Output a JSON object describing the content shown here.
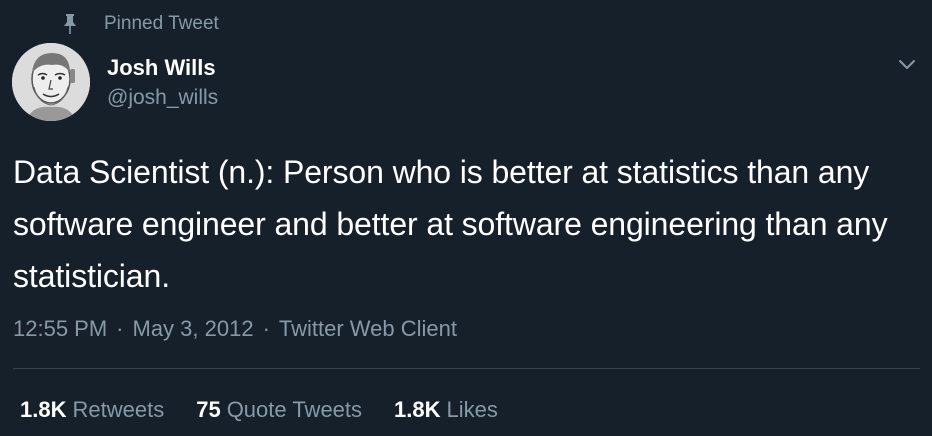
{
  "pinned": {
    "label": "Pinned Tweet",
    "icon": "pin-icon"
  },
  "author": {
    "name": "Josh Wills",
    "handle": "@josh_wills",
    "avatar_icon": "sketch-portrait"
  },
  "tweet": {
    "text": "Data Scientist (n.): Person who is better at statistics than any software engineer and better at software engineering than any statistician.",
    "time": "12:55 PM",
    "date": "May 3, 2012",
    "separator": "·",
    "source": "Twitter Web Client"
  },
  "stats": {
    "retweets_count": "1.8K",
    "retweets_label": "Retweets",
    "quotes_count": "75",
    "quotes_label": "Quote Tweets",
    "likes_count": "1.8K",
    "likes_label": "Likes"
  },
  "colors": {
    "background": "#15202b",
    "text_primary": "#ffffff",
    "text_secondary": "#8899a6",
    "divider": "#38444d"
  }
}
